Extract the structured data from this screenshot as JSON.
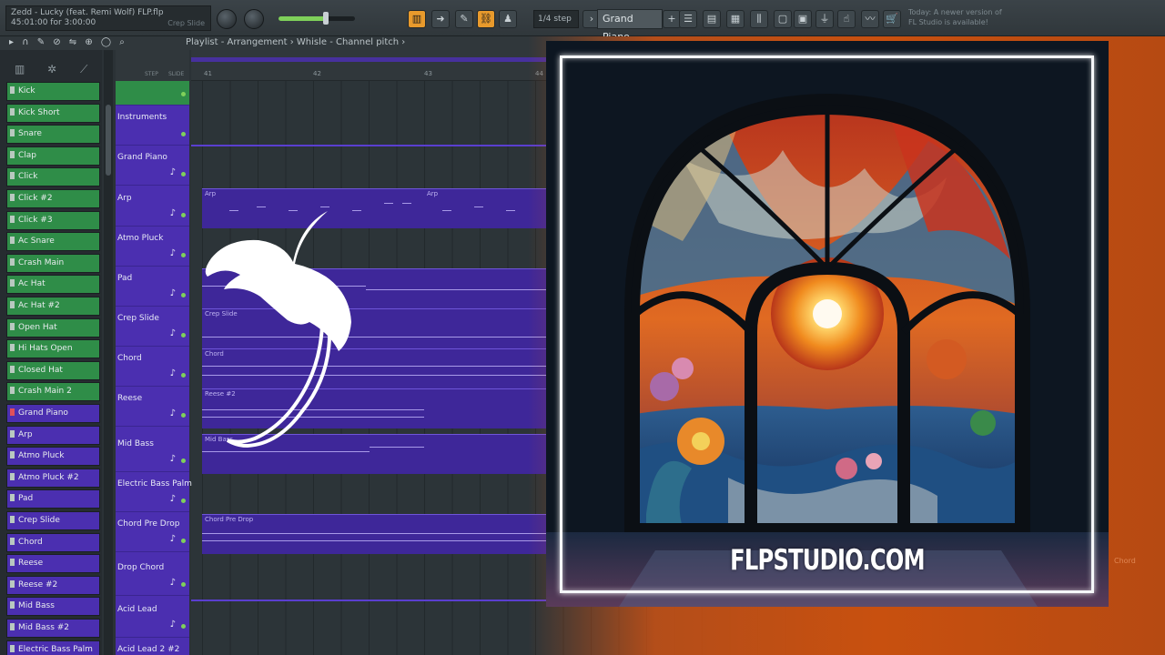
{
  "toolbar": {
    "song_title": "Zedd - Lucky (feat. Remi Wolf) FLP.flp",
    "song_time": "45:01:00 for 3:00:00",
    "hint_channel": "Crep Slide",
    "snap": "1/4 step",
    "pattern": "Grand Piano",
    "news": "Today: A newer version of FL Studio is available!",
    "master_volume": 0.62
  },
  "navbar": {
    "breadcrumb": "Playlist - Arrangement  ›  Whisle - Channel pitch  ›"
  },
  "rack": {
    "channels": [
      {
        "label": "Kick",
        "color": "green"
      },
      {
        "label": "Kick Short",
        "color": "green"
      },
      {
        "label": "Snare",
        "color": "green"
      },
      {
        "label": "Clap",
        "color": "green"
      },
      {
        "label": "Click",
        "color": "green"
      },
      {
        "label": "Click #2",
        "color": "green"
      },
      {
        "label": "Click #3",
        "color": "green"
      },
      {
        "label": "Ac Snare",
        "color": "green"
      },
      {
        "label": "Crash Main",
        "color": "green"
      },
      {
        "label": "Ac Hat",
        "color": "green"
      },
      {
        "label": "Ac Hat #2",
        "color": "green"
      },
      {
        "label": "Open Hat",
        "color": "green"
      },
      {
        "label": "Hi Hats Open",
        "color": "green"
      },
      {
        "label": "Closed Hat",
        "color": "green"
      },
      {
        "label": "Crash Main 2",
        "color": "green"
      },
      {
        "label": "Grand Piano",
        "color": "purple"
      },
      {
        "label": "Arp",
        "color": "purple"
      },
      {
        "label": "Atmo Pluck",
        "color": "purple"
      },
      {
        "label": "Atmo Pluck #2",
        "color": "purple"
      },
      {
        "label": "Pad",
        "color": "purple"
      },
      {
        "label": "Crep Slide",
        "color": "purple"
      },
      {
        "label": "Chord",
        "color": "purple"
      },
      {
        "label": "Reese",
        "color": "purple"
      },
      {
        "label": "Reese #2",
        "color": "purple"
      },
      {
        "label": "Mid Bass",
        "color": "purple"
      },
      {
        "label": "Mid Bass #2",
        "color": "purple"
      },
      {
        "label": "Electric Bass Palm",
        "color": "purple"
      }
    ]
  },
  "playlist": {
    "header_step": "STEP",
    "header_slide": "SLIDE",
    "bars": [
      "41",
      "42",
      "43",
      "44"
    ],
    "tracks": [
      "",
      "Instruments",
      "Grand Piano",
      "Arp",
      "Atmo Pluck",
      "Pad",
      "Crep Slide",
      "Chord",
      "Reese",
      "Mid Bass",
      "Electric Bass Palm",
      "Chord Pre Drop",
      "Drop Chord",
      "Acid Lead",
      "Acid Lead 2 #2"
    ],
    "clip_labels": {
      "arp_a": "Arp",
      "arp_b": "Arp",
      "crep": "Crep Slide",
      "chord": "Chord",
      "reese": "Reese #2",
      "midbass": "Mid Bass",
      "chord_pre": "Chord Pre Drop"
    }
  },
  "artwork": {
    "brand": "FLPSTUDIO.COM",
    "ghost_label": "Chord"
  },
  "colors": {
    "accent_green": "#2f8d48",
    "accent_purple": "#4b2fb0",
    "accent_orange": "#c8500f"
  }
}
